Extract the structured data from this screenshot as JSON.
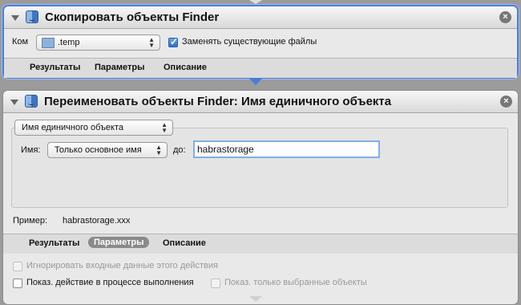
{
  "colors": {
    "accent": "#4a7dd6",
    "background": "#9b9b9b"
  },
  "action1": {
    "title": "Скопировать объекты Finder",
    "icon": "finder-icon",
    "to_label": "Ком",
    "folder_value": ".temp",
    "replace_label": "Заменять существующие файлы",
    "replace_checked": true,
    "tabs": [
      "Результаты",
      "Параметры",
      "Описание"
    ]
  },
  "action2": {
    "title": "Переименовать объекты Finder: Имя единичного объекта",
    "icon": "finder-icon",
    "mode_value": "Имя единичного объекта",
    "name_label": "Имя:",
    "name_option": "Только основное имя",
    "to_label": "до:",
    "new_name_value": "habrastorage",
    "example_label": "Пример:",
    "example_value": "habrastorage.xxx",
    "tabs": [
      "Результаты",
      "Параметры",
      "Описание"
    ],
    "selected_tab": "Параметры",
    "ignore_input_label": "Игнорировать входные данные этого действия",
    "show_action_label": "Показ. действие в процессе выполнения",
    "show_selected_label": "Показ. только выбранные объекты"
  }
}
